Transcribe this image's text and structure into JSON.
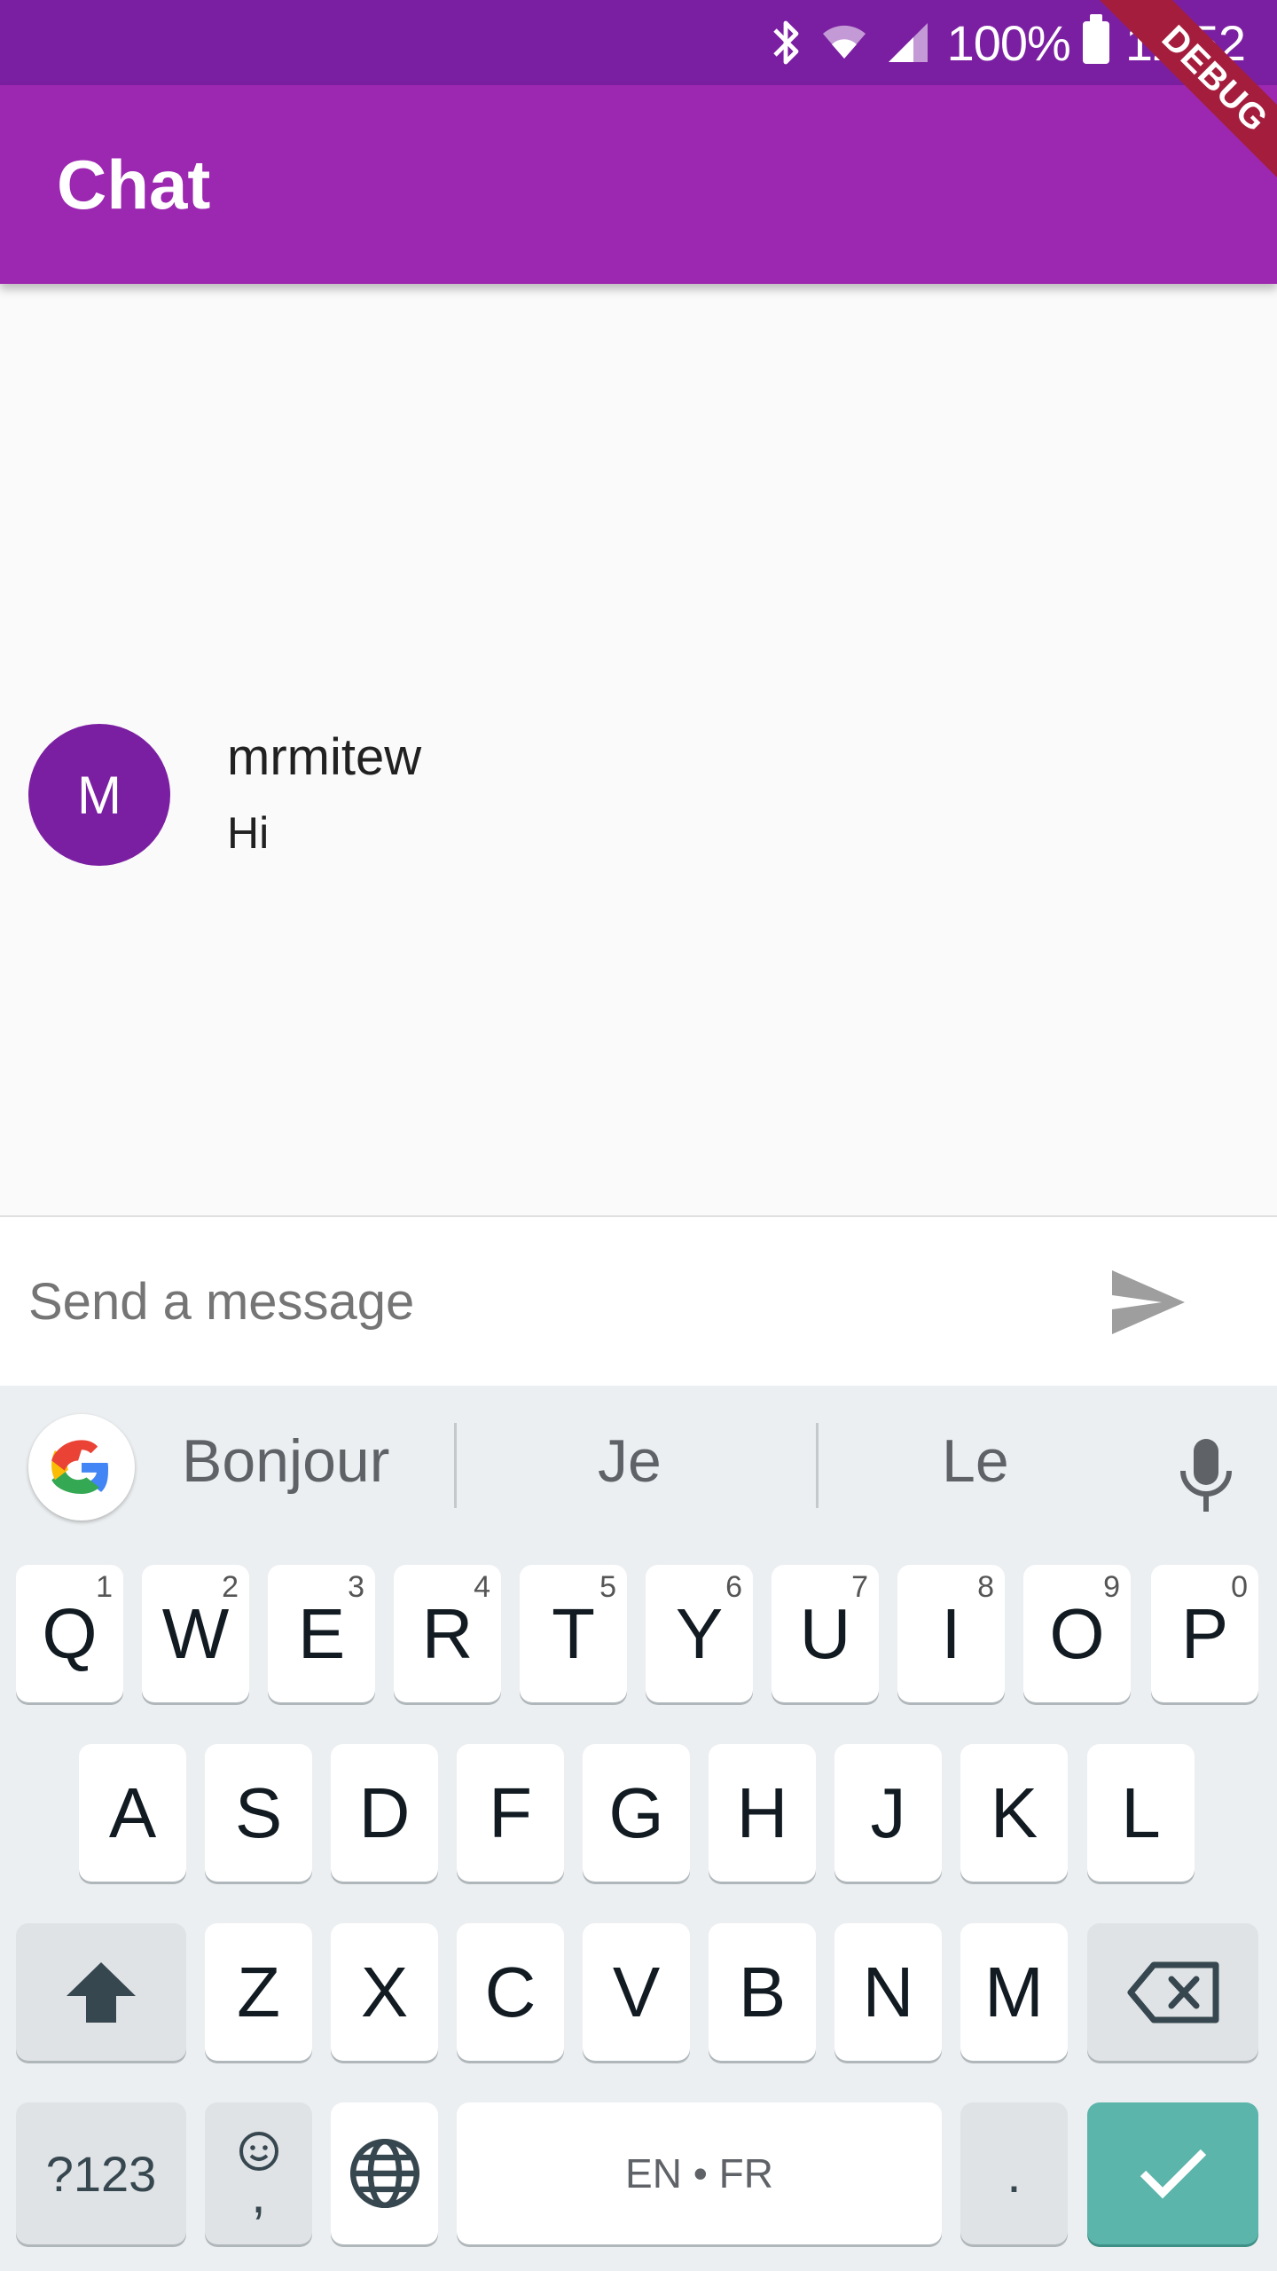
{
  "status_bar": {
    "battery_percent": "100%",
    "time": "12:52",
    "icons": [
      "bluetooth-icon",
      "wifi-icon",
      "signal-icon",
      "battery-icon"
    ]
  },
  "app_bar": {
    "title": "Chat"
  },
  "debug_banner": {
    "label": "DEBUG"
  },
  "messages": [
    {
      "avatar_initial": "M",
      "sender": "mrmitew",
      "text": "Hi"
    }
  ],
  "composer": {
    "placeholder": "Send a message",
    "value": ""
  },
  "keyboard": {
    "suggestions": [
      "Bonjour",
      "Je",
      "Le"
    ],
    "row1": [
      {
        "key": "Q",
        "hint": "1"
      },
      {
        "key": "W",
        "hint": "2"
      },
      {
        "key": "E",
        "hint": "3"
      },
      {
        "key": "R",
        "hint": "4"
      },
      {
        "key": "T",
        "hint": "5"
      },
      {
        "key": "Y",
        "hint": "6"
      },
      {
        "key": "U",
        "hint": "7"
      },
      {
        "key": "I",
        "hint": "8"
      },
      {
        "key": "O",
        "hint": "9"
      },
      {
        "key": "P",
        "hint": "0"
      }
    ],
    "row2": [
      "A",
      "S",
      "D",
      "F",
      "G",
      "H",
      "J",
      "K",
      "L"
    ],
    "row3": [
      "Z",
      "X",
      "C",
      "V",
      "B",
      "N",
      "M"
    ],
    "symbols_label": "?123",
    "comma_label": ",",
    "space_label": "EN • FR",
    "period_label": "."
  },
  "colors": {
    "status_bar": "#7b1fa2",
    "app_bar": "#9c27b0",
    "avatar": "#7b1fa2",
    "enter_key": "#5bb5ab",
    "debug_banner": "#a51d3c"
  }
}
